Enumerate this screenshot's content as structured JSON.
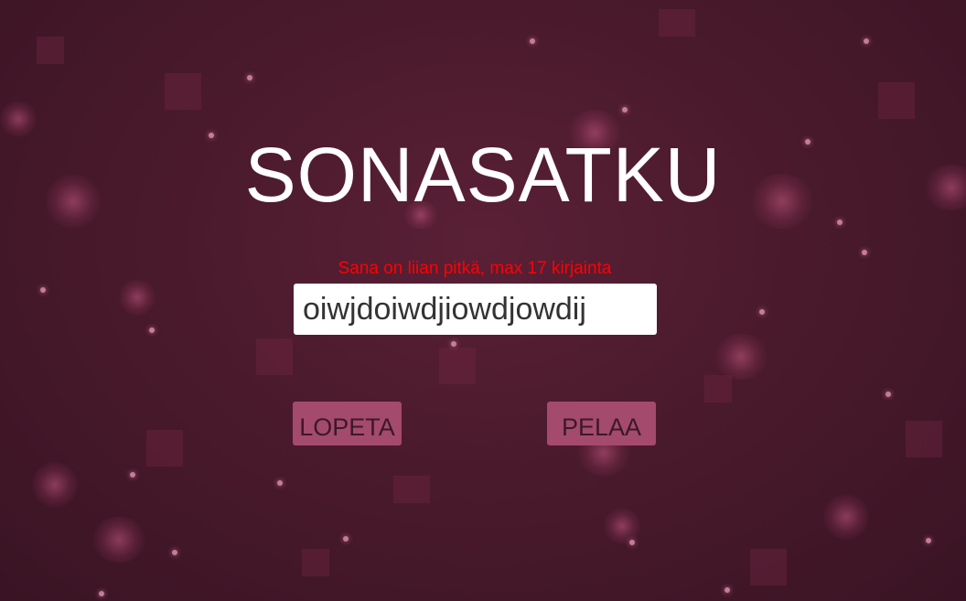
{
  "game": {
    "title": "SONASATKU",
    "error_message": "Sana on liian pitkä, max 17 kirjainta",
    "error_color": "#ff0000",
    "word_input": {
      "value": "oiwjdoiwdjiowdjowdij",
      "placeholder": ""
    },
    "buttons": {
      "quit_label": "LOPETA",
      "play_label": "PELAA"
    },
    "colors": {
      "background": "#4a1a2e",
      "button": "#a44a6c",
      "title": "#ffffff"
    }
  }
}
